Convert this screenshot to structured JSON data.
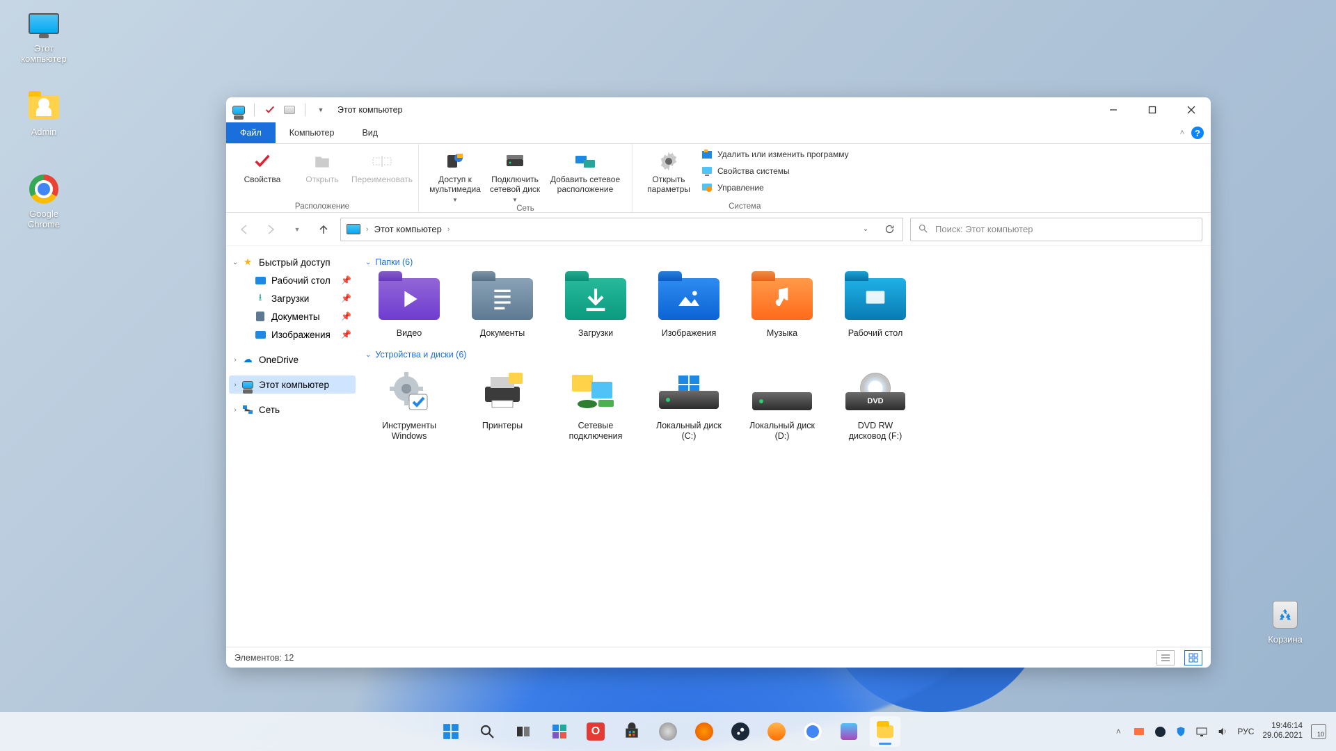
{
  "desktop": {
    "icons": [
      {
        "name": "this-pc",
        "label": "Этот\nкомпьютер"
      },
      {
        "name": "admin-folder",
        "label": "Admin"
      },
      {
        "name": "google-chrome",
        "label": "Google\nChrome"
      },
      {
        "name": "recycle-bin",
        "label": "Корзина"
      }
    ]
  },
  "window": {
    "title": "Этот компьютер",
    "tabs": {
      "file": "Файл",
      "computer": "Компьютер",
      "view": "Вид"
    },
    "ribbon": {
      "properties": "Свойства",
      "open": "Открыть",
      "rename": "Переименовать",
      "group_location": "Расположение",
      "media_access": "Доступ к\nмультимедиа",
      "map_drive": "Подключить\nсетевой диск",
      "add_net_loc": "Добавить сетевое\nрасположение",
      "group_network": "Сеть",
      "open_settings": "Открыть\nпараметры",
      "uninstall": "Удалить или изменить программу",
      "system_props": "Свойства системы",
      "manage": "Управление",
      "group_system": "Система"
    },
    "breadcrumb": "Этот компьютер",
    "search_placeholder": "Поиск: Этот компьютер",
    "sidebar": {
      "quick": "Быстрый доступ",
      "desktop": "Рабочий стол",
      "downloads": "Загрузки",
      "documents": "Документы",
      "pictures": "Изображения",
      "onedrive": "OneDrive",
      "this_pc": "Этот компьютер",
      "network": "Сеть"
    },
    "groups": {
      "folders_header": "Папки (6)",
      "devices_header": "Устройства и диски (6)"
    },
    "folders": [
      {
        "name": "videos",
        "label": "Видео"
      },
      {
        "name": "documents",
        "label": "Документы"
      },
      {
        "name": "downloads",
        "label": "Загрузки"
      },
      {
        "name": "pictures",
        "label": "Изображения"
      },
      {
        "name": "music",
        "label": "Музыка"
      },
      {
        "name": "desktop",
        "label": "Рабочий стол"
      }
    ],
    "devices": [
      {
        "name": "windows-tools",
        "label": "Инструменты\nWindows"
      },
      {
        "name": "printers",
        "label": "Принтеры"
      },
      {
        "name": "network-connections",
        "label": "Сетевые\nподключения"
      },
      {
        "name": "local-disk-c",
        "label": "Локальный диск\n(C:)"
      },
      {
        "name": "local-disk-d",
        "label": "Локальный диск\n(D:)"
      },
      {
        "name": "dvd-rw-f",
        "label": "DVD RW\nдисковод (F:)",
        "badge": "DVD"
      }
    ],
    "status": "Элементов: 12"
  },
  "taskbar": {
    "tray": {
      "lang": "РУС",
      "time": "19:46:14",
      "date": "29.06.2021",
      "notif_count": "10"
    }
  }
}
